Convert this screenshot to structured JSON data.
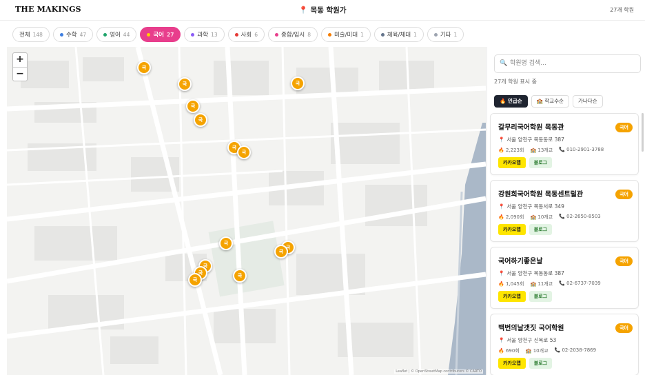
{
  "header": {
    "logo": "THE MAKINGS",
    "title": "목동 학원가",
    "count": "27개 학원"
  },
  "categories": [
    {
      "label": "전체",
      "count": "148",
      "color": "",
      "active": false
    },
    {
      "label": "수학",
      "count": "47",
      "color": "#3f7fe0",
      "active": false
    },
    {
      "label": "영어",
      "count": "44",
      "color": "#1fa46b",
      "active": false
    },
    {
      "label": "국어",
      "count": "27",
      "color": "#f5a300",
      "active": true
    },
    {
      "label": "과학",
      "count": "13",
      "color": "#8b5cf6",
      "active": false
    },
    {
      "label": "사회",
      "count": "6",
      "color": "#e53935",
      "active": false
    },
    {
      "label": "종합/입시",
      "count": "8",
      "color": "#e83e8c",
      "active": false
    },
    {
      "label": "미술/미대",
      "count": "1",
      "color": "#f57c00",
      "active": false
    },
    {
      "label": "체육/체대",
      "count": "1",
      "color": "#64748b",
      "active": false
    },
    {
      "label": "기타",
      "count": "1",
      "color": "#9ca3af",
      "active": false
    }
  ],
  "map": {
    "zoom_in": "+",
    "zoom_out": "−",
    "marker_label": "국",
    "attribution": "Leaflet | © OpenStreetMap contributors © CARTO"
  },
  "sidebar": {
    "search_placeholder": "학원명 검색...",
    "shown_text": "27개 학원 표시 중",
    "sorts": [
      {
        "label": "인급순",
        "icon": "fire-icon",
        "active": true
      },
      {
        "label": "학교수순",
        "icon": "school-icon",
        "active": false
      },
      {
        "label": "가나다순",
        "icon": "",
        "active": false
      }
    ],
    "academies": [
      {
        "name": "갈무리국어학원 목동관",
        "badge": "국어",
        "address": "서울 양천구 목동동로 387",
        "reviews": "2,223회",
        "schools": "13개교",
        "phone": "010-2901-3788",
        "kakao": "카카오맵",
        "blog": "블로그"
      },
      {
        "name": "강원희국어학원 목동센트럴관",
        "badge": "국어",
        "address": "서울 양천구 목동서로 349",
        "reviews": "2,090회",
        "schools": "10개교",
        "phone": "02-2650-8503",
        "kakao": "카카오맵",
        "blog": "블로그"
      },
      {
        "name": "국어하기좋은날",
        "badge": "국어",
        "address": "서울 양천구 목동동로 387",
        "reviews": "1,045회",
        "schools": "11개교",
        "phone": "02-6737-7039",
        "kakao": "카카오맵",
        "blog": "블로그"
      },
      {
        "name": "백번의날갯짓 국어학원",
        "badge": "국어",
        "address": "서울 양천구 신목로 53",
        "reviews": "690회",
        "schools": "10개교",
        "phone": "02-2038-7869",
        "kakao": "카카오맵",
        "blog": "블로그"
      }
    ]
  },
  "colors": {
    "accent_pink": "#e83e8c",
    "marker_orange": "#f5a300",
    "kakao_yellow": "#fee500"
  }
}
